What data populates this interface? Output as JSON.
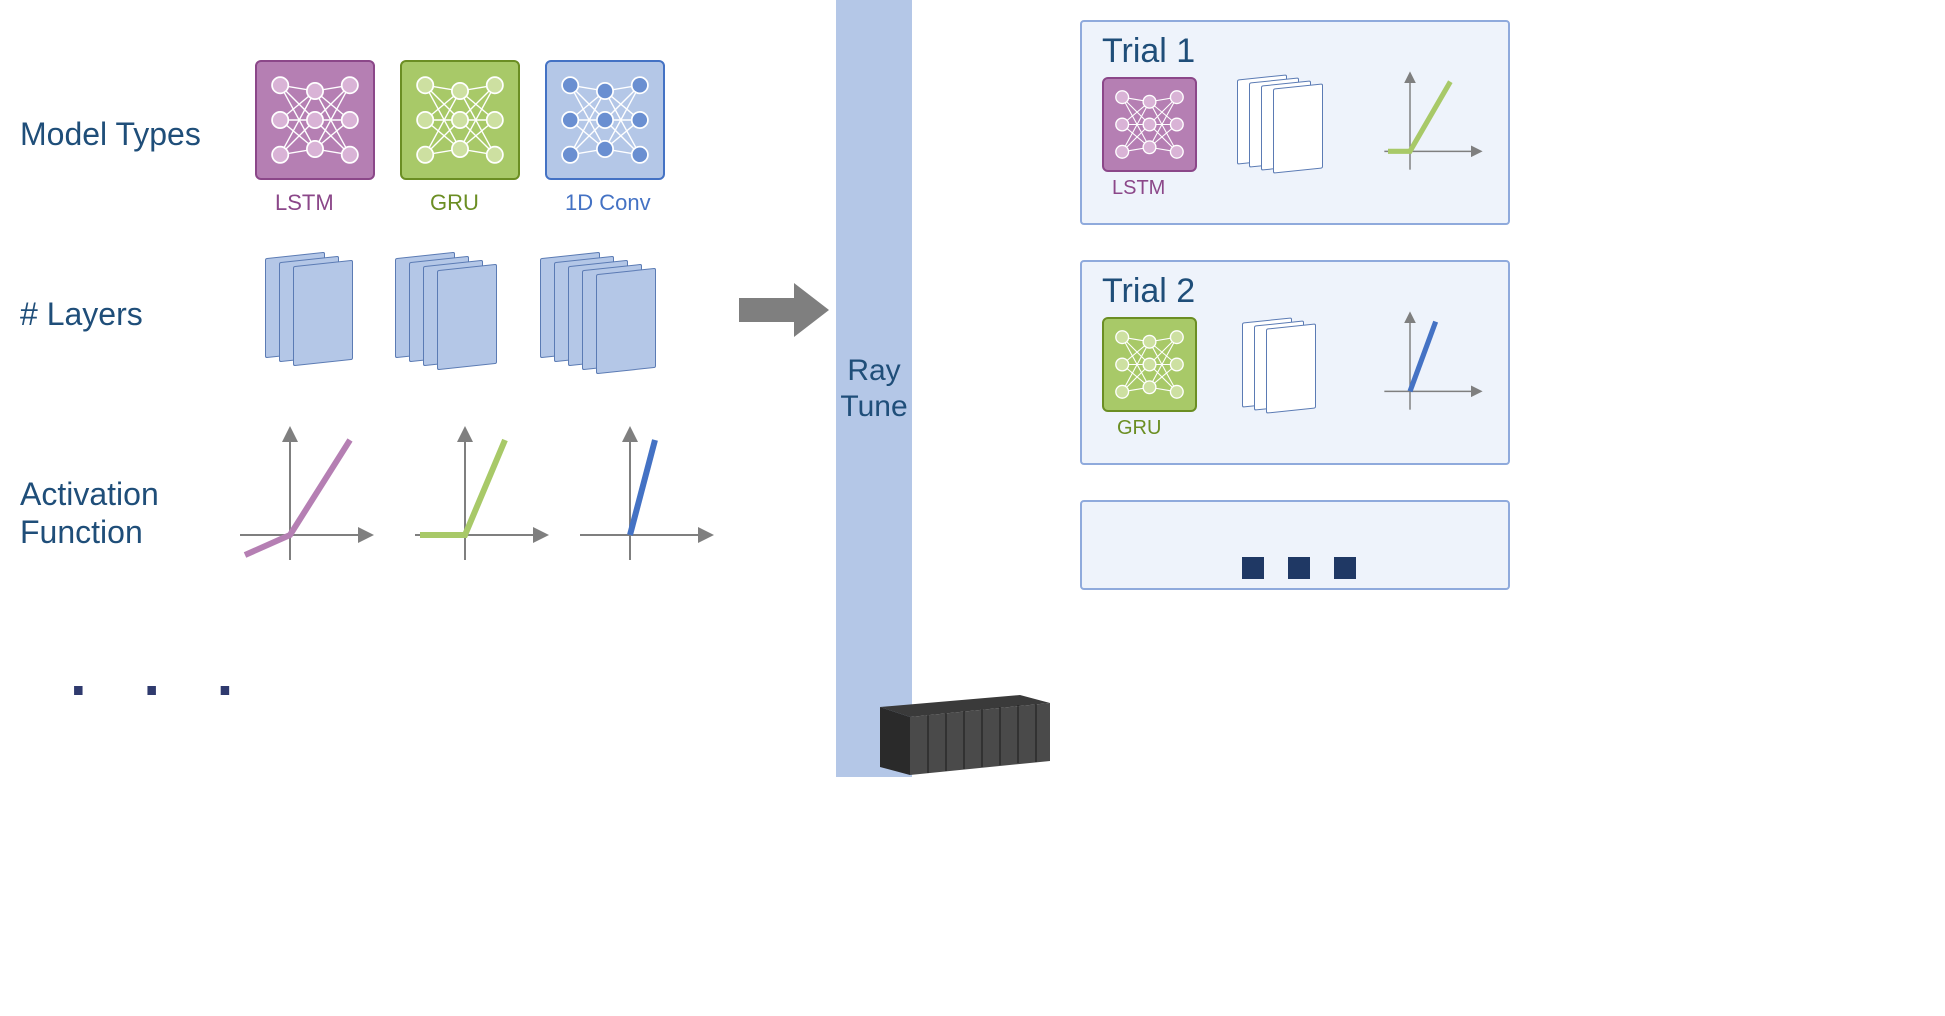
{
  "rows": {
    "modelTypes": {
      "label": "Model Types",
      "items": [
        "LSTM",
        "GRU",
        "1D Conv"
      ]
    },
    "layers": {
      "label": "# Layers"
    },
    "activation": {
      "label": "Activation\nFunction"
    }
  },
  "pipeline": {
    "name": "Ray\nTune"
  },
  "trials": [
    {
      "title": "Trial 1",
      "model": "LSTM"
    },
    {
      "title": "Trial 2",
      "model": "GRU"
    }
  ],
  "colors": {
    "lstm": "#b57fb3",
    "gru": "#a8c968",
    "conv": "#b4c7e7",
    "relu_purple": "#b57fb3",
    "relu_green": "#a8c968",
    "relu_blue": "#4472c4",
    "axis": "#7f7f7f"
  }
}
